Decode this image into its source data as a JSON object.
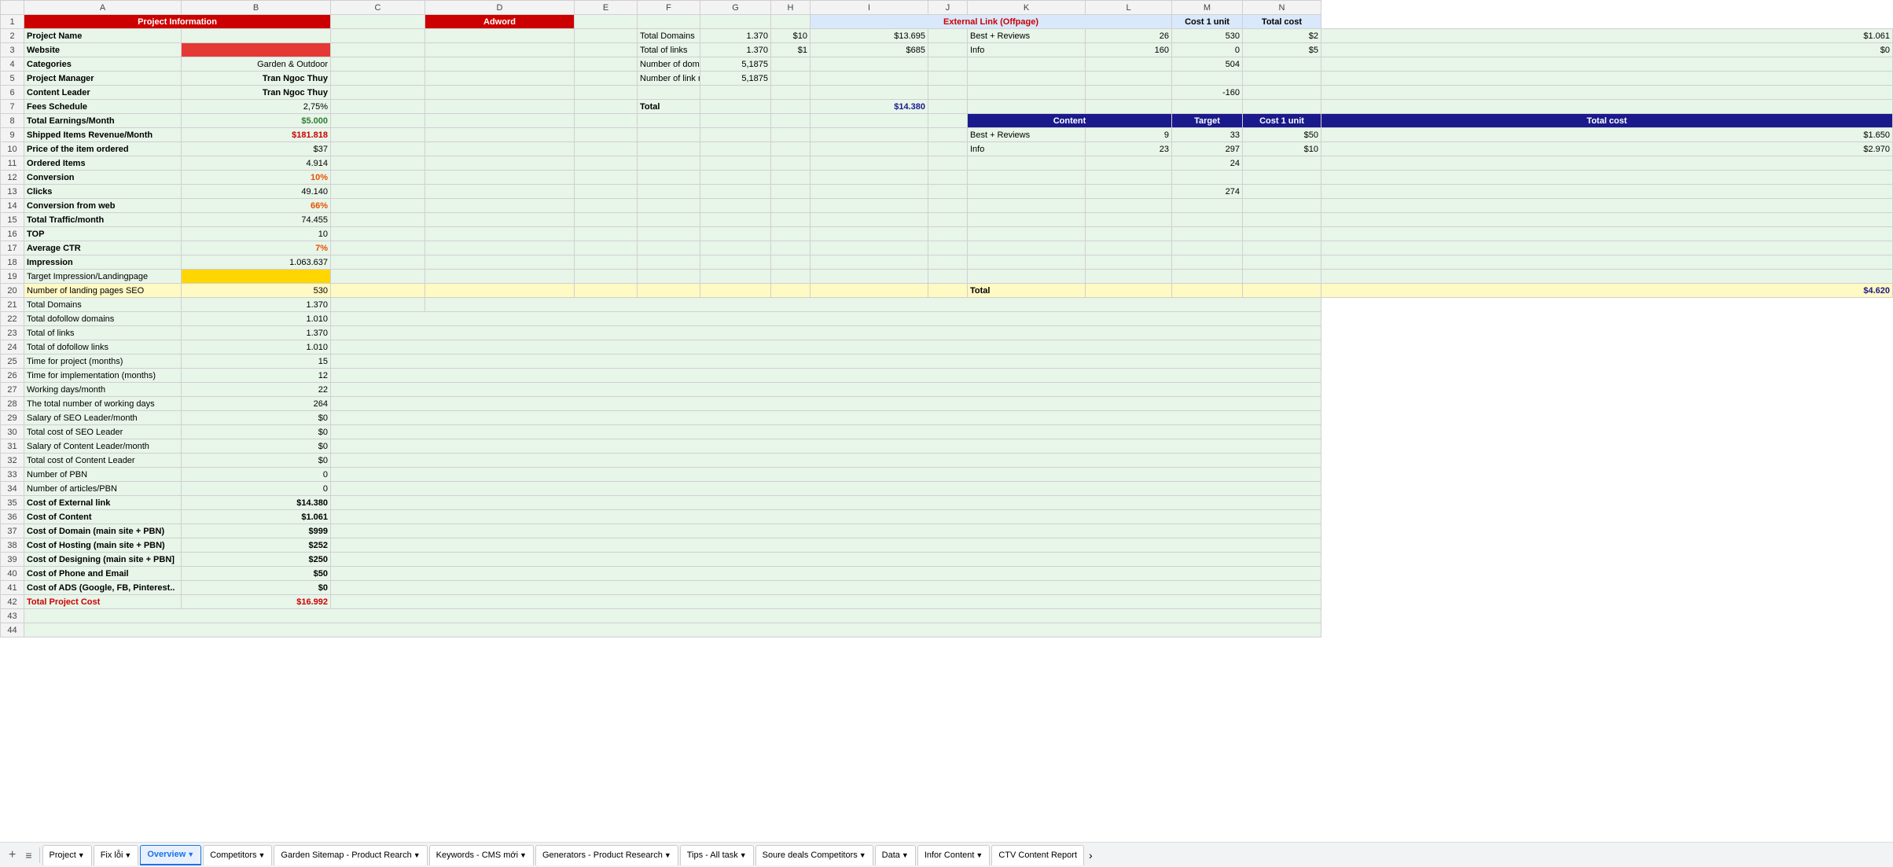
{
  "columns": {
    "row": "",
    "a": "A",
    "b": "B",
    "c": "C",
    "d": "D",
    "e": "E",
    "f": "F",
    "g": "G",
    "h": "H",
    "i": "I",
    "j": "J",
    "k": "K",
    "l": "L",
    "m": "M"
  },
  "rows": [
    {
      "num": 1,
      "a": "Project Information",
      "b": "",
      "c": "",
      "d": "Adword",
      "e": "",
      "f": "",
      "g": "",
      "h": "",
      "i": "External Link (Offpage)",
      "j": "",
      "k": "Cost 1 unit",
      "l": "Total cost",
      "m": "",
      "n": "Content",
      "o": "",
      "p": "Target",
      "q": "Cost 1 unit",
      "r": "Total cost"
    },
    {
      "num": 2,
      "a": "Project Name",
      "b": "",
      "c": "",
      "d": "",
      "e": "",
      "f": "Total Domains",
      "g": "1.370",
      "h": "$10",
      "i": "$13.695",
      "j": "Best + Reviews",
      "k": "26",
      "l": "530",
      "m": "$2",
      "n": "$1.061"
    },
    {
      "num": 3,
      "a": "Website",
      "b": "red",
      "c": "",
      "d": "",
      "e": "",
      "f": "Total of links",
      "g": "1.370",
      "h": "$1",
      "i": "$685",
      "j": "Info",
      "k": "160",
      "l": "0",
      "m": "$5",
      "n": "$0"
    },
    {
      "num": 4,
      "a": "Categories",
      "b": "Garden & Outdoor",
      "c": "",
      "d": "",
      "e": "",
      "f": "Number of domain referring/d",
      "g": "5,1875",
      "h": "",
      "i": "",
      "j": "",
      "k": "",
      "l": "504",
      "m": "",
      "n": ""
    },
    {
      "num": 5,
      "a": "Project Manager",
      "b": "Tran Ngoc Thuy",
      "c": "",
      "d": "",
      "e": "",
      "f": "Number of link referring/day",
      "g": "5,1875",
      "h": "",
      "i": "",
      "j": "",
      "k": "",
      "l": "",
      "m": "",
      "n": ""
    },
    {
      "num": 6,
      "a": "Content Leader",
      "b": "Tran Ngoc Thuy",
      "c": "",
      "d": "",
      "e": "",
      "f": "",
      "g": "",
      "h": "",
      "i": "",
      "j": "",
      "k": "",
      "l": "-160",
      "m": "",
      "n": ""
    },
    {
      "num": 7,
      "a": "Fees Schedule",
      "b": "2,75%",
      "c": "",
      "d": "",
      "e": "",
      "f": "Total",
      "g": "",
      "h": "",
      "i": "$14.380",
      "j": "",
      "k": "",
      "l": "",
      "m": "",
      "n": ""
    },
    {
      "num": 8,
      "a": "Total Earnings/Month",
      "b": "$5.000",
      "c": "",
      "d": "",
      "e": "",
      "f": "",
      "g": "",
      "h": "",
      "i": "",
      "j": "",
      "k": "",
      "l": "",
      "m": "",
      "n": "Total"
    },
    {
      "num": 9,
      "a": "Shipped Items Revenue/Month",
      "b": "$181.818",
      "c": "",
      "d": "",
      "e": "",
      "f": "",
      "g": "",
      "h": "",
      "i": "",
      "j": "Best + Reviews",
      "k": "9",
      "l": "33",
      "m": "$50",
      "n": "$1.650"
    },
    {
      "num": 10,
      "a": "Price of the item ordered",
      "b": "$37",
      "c": "",
      "d": "",
      "e": "",
      "f": "",
      "g": "",
      "h": "",
      "i": "",
      "j": "Info",
      "k": "23",
      "l": "297",
      "m": "$10",
      "n": "$2.970"
    },
    {
      "num": 11,
      "a": "Ordered Items",
      "b": "4.914",
      "c": "",
      "d": "",
      "e": "",
      "f": "",
      "g": "",
      "h": "",
      "i": "",
      "j": "",
      "k": "",
      "l": "24",
      "m": "",
      "n": ""
    },
    {
      "num": 12,
      "a": "Conversion",
      "b": "10%",
      "c": "",
      "d": "",
      "e": "",
      "f": "",
      "g": "",
      "h": "",
      "i": "",
      "j": "",
      "k": "",
      "l": "",
      "m": "",
      "n": ""
    },
    {
      "num": 13,
      "a": "Clicks",
      "b": "49.140",
      "c": "",
      "d": "",
      "e": "",
      "f": "",
      "g": "",
      "h": "",
      "i": "",
      "j": "",
      "k": "",
      "l": "274",
      "m": "",
      "n": ""
    },
    {
      "num": 14,
      "a": "Conversion from web",
      "b": "66%",
      "c": "",
      "d": "",
      "e": "",
      "f": "",
      "g": "",
      "h": "",
      "i": "",
      "j": "",
      "k": "",
      "l": "",
      "m": "",
      "n": ""
    },
    {
      "num": 15,
      "a": "Total Traffic/month",
      "b": "74.455",
      "c": "",
      "d": "",
      "e": "",
      "f": "",
      "g": "",
      "h": "",
      "i": "",
      "j": "",
      "k": "",
      "l": "",
      "m": "",
      "n": ""
    },
    {
      "num": 16,
      "a": "TOP",
      "b": "10",
      "c": "",
      "d": "",
      "e": "",
      "f": "",
      "g": "",
      "h": "",
      "i": "",
      "j": "",
      "k": "",
      "l": "",
      "m": "",
      "n": ""
    },
    {
      "num": 17,
      "a": "Average CTR",
      "b": "7%",
      "c": "",
      "d": "",
      "e": "",
      "f": "",
      "g": "",
      "h": "",
      "i": "",
      "j": "",
      "k": "",
      "l": "",
      "m": "",
      "n": ""
    },
    {
      "num": 18,
      "a": "Impression",
      "b": "1.063.637",
      "c": "",
      "d": "",
      "e": "",
      "f": "",
      "g": "",
      "h": "",
      "i": "",
      "j": "",
      "k": "",
      "l": "",
      "m": "",
      "n": ""
    },
    {
      "num": 19,
      "a": "Target Impression/Landingpage",
      "b": "yellow",
      "c": "",
      "d": "",
      "e": "",
      "f": "",
      "g": "",
      "h": "",
      "i": "",
      "j": "",
      "k": "",
      "l": "",
      "m": "",
      "n": ""
    },
    {
      "num": 20,
      "a": "Number of landing pages SEO",
      "b": "530",
      "c": "",
      "d": "",
      "e": "",
      "f": "",
      "g": "",
      "h": "",
      "i": "",
      "j": "Total",
      "k": "",
      "l": "",
      "m": "",
      "n": "$4.620"
    },
    {
      "num": 21,
      "a": "Total Domains",
      "b": "1.370",
      "c": "",
      "d": "",
      "e": "",
      "f": "",
      "g": "",
      "h": "",
      "i": "",
      "j": "",
      "k": "",
      "l": "",
      "m": "",
      "n": ""
    },
    {
      "num": 22,
      "a": "Total dofollow domains",
      "b": "1.010",
      "c": "",
      "d": "",
      "e": "",
      "f": "",
      "g": "",
      "h": "",
      "i": "",
      "j": "",
      "k": "",
      "l": "",
      "m": "",
      "n": ""
    },
    {
      "num": 23,
      "a": "Total of links",
      "b": "1.370",
      "c": "",
      "d": "",
      "e": "",
      "f": "",
      "g": "",
      "h": "",
      "i": "",
      "j": "",
      "k": "",
      "l": "",
      "m": "",
      "n": ""
    },
    {
      "num": 24,
      "a": "Total of dofollow links",
      "b": "1.010",
      "c": "",
      "d": "",
      "e": "",
      "f": "",
      "g": "",
      "h": "",
      "i": "",
      "j": "",
      "k": "",
      "l": "",
      "m": "",
      "n": ""
    },
    {
      "num": 25,
      "a": "Time for project (months)",
      "b": "15",
      "c": "",
      "d": "",
      "e": "",
      "f": "",
      "g": "",
      "h": "",
      "i": "",
      "j": "",
      "k": "",
      "l": "",
      "m": "",
      "n": ""
    },
    {
      "num": 26,
      "a": "Time for implementation (months)",
      "b": "12",
      "c": "",
      "d": "",
      "e": "",
      "f": "",
      "g": "",
      "h": "",
      "i": "",
      "j": "",
      "k": "",
      "l": "",
      "m": "",
      "n": ""
    },
    {
      "num": 27,
      "a": "Working days/month",
      "b": "22",
      "c": "",
      "d": "",
      "e": "",
      "f": "",
      "g": "",
      "h": "",
      "i": "",
      "j": "",
      "k": "",
      "l": "",
      "m": "",
      "n": ""
    },
    {
      "num": 28,
      "a": "The total number of working days",
      "b": "264",
      "c": "",
      "d": "",
      "e": "",
      "f": "",
      "g": "",
      "h": "",
      "i": "",
      "j": "",
      "k": "",
      "l": "",
      "m": "",
      "n": ""
    },
    {
      "num": 29,
      "a": "Salary of SEO Leader/month",
      "b": "$0",
      "c": "",
      "d": "",
      "e": "",
      "f": "",
      "g": "",
      "h": "",
      "i": "",
      "j": "",
      "k": "",
      "l": "",
      "m": "",
      "n": ""
    },
    {
      "num": 30,
      "a": "Total cost of SEO Leader",
      "b": "$0",
      "c": "",
      "d": "",
      "e": "",
      "f": "",
      "g": "",
      "h": "",
      "i": "",
      "j": "",
      "k": "",
      "l": "",
      "m": "",
      "n": ""
    },
    {
      "num": 31,
      "a": "Salary of Content Leader/month",
      "b": "$0",
      "c": "",
      "d": "",
      "e": "",
      "f": "",
      "g": "",
      "h": "",
      "i": "",
      "j": "",
      "k": "",
      "l": "",
      "m": "",
      "n": ""
    },
    {
      "num": 32,
      "a": "Total cost of Content Leader",
      "b": "$0",
      "c": "",
      "d": "",
      "e": "",
      "f": "",
      "g": "",
      "h": "",
      "i": "",
      "j": "",
      "k": "",
      "l": "",
      "m": "",
      "n": ""
    },
    {
      "num": 33,
      "a": "Number of PBN",
      "b": "0",
      "c": "",
      "d": "",
      "e": "",
      "f": "",
      "g": "",
      "h": "",
      "i": "",
      "j": "",
      "k": "",
      "l": "",
      "m": "",
      "n": ""
    },
    {
      "num": 34,
      "a": "Number of articles/PBN",
      "b": "0",
      "c": "",
      "d": "",
      "e": "",
      "f": "",
      "g": "",
      "h": "",
      "i": "",
      "j": "",
      "k": "",
      "l": "",
      "m": "",
      "n": ""
    },
    {
      "num": 35,
      "a": "Cost of External link",
      "b": "$14.380",
      "c": "",
      "d": "",
      "e": "",
      "f": "",
      "g": "",
      "h": "",
      "i": "",
      "j": "",
      "k": "",
      "l": "",
      "m": "",
      "n": ""
    },
    {
      "num": 36,
      "a": "Cost of Content",
      "b": "$1.061",
      "c": "",
      "d": "",
      "e": "",
      "f": "",
      "g": "",
      "h": "",
      "i": "",
      "j": "",
      "k": "",
      "l": "",
      "m": "",
      "n": ""
    },
    {
      "num": 37,
      "a": "Cost of Domain (main site + PBN)",
      "b": "$999",
      "c": "",
      "d": "",
      "e": "",
      "f": "",
      "g": "",
      "h": "",
      "i": "",
      "j": "",
      "k": "",
      "l": "",
      "m": "",
      "n": ""
    },
    {
      "num": 38,
      "a": "Cost of Hosting (main site + PBN)",
      "b": "$252",
      "c": "",
      "d": "",
      "e": "",
      "f": "",
      "g": "",
      "h": "",
      "i": "",
      "j": "",
      "k": "",
      "l": "",
      "m": "",
      "n": ""
    },
    {
      "num": 39,
      "a": "Cost of Designing (main site + PBN]",
      "b": "$250",
      "c": "",
      "d": "",
      "e": "",
      "f": "",
      "g": "",
      "h": "",
      "i": "",
      "j": "",
      "k": "",
      "l": "",
      "m": "",
      "n": ""
    },
    {
      "num": 40,
      "a": "Cost of Phone and Email",
      "b": "$50",
      "c": "",
      "d": "",
      "e": "",
      "f": "",
      "g": "",
      "h": "",
      "i": "",
      "j": "",
      "k": "",
      "l": "",
      "m": "",
      "n": ""
    },
    {
      "num": 41,
      "a": "Cost of ADS (Google, FB, Pinterest..",
      "b": "$0",
      "c": "",
      "d": "",
      "e": "",
      "f": "",
      "g": "",
      "h": "",
      "i": "",
      "j": "",
      "k": "",
      "l": "",
      "m": "",
      "n": ""
    },
    {
      "num": 42,
      "a": "Total Project Cost",
      "b": "$16.992",
      "c": "",
      "d": "",
      "e": "",
      "f": "",
      "g": "",
      "h": "",
      "i": "",
      "j": "",
      "k": "",
      "l": "",
      "m": "",
      "n": ""
    },
    {
      "num": 43,
      "a": "",
      "b": "",
      "c": "",
      "d": ""
    },
    {
      "num": 44,
      "a": "",
      "b": "",
      "c": "",
      "d": ""
    }
  ],
  "tabs": [
    {
      "label": "+",
      "type": "add"
    },
    {
      "label": "≡",
      "type": "menu"
    },
    {
      "label": "Project",
      "type": "sheet",
      "active": false
    },
    {
      "label": "Fix lỗi",
      "type": "sheet",
      "active": false
    },
    {
      "label": "Overview",
      "type": "sheet",
      "active": true
    },
    {
      "label": "Competitors",
      "type": "sheet",
      "active": false
    },
    {
      "label": "Garden Sitemap - Product Rearch",
      "type": "sheet",
      "active": false
    },
    {
      "label": "Keywords - CMS mới",
      "type": "sheet",
      "active": false
    },
    {
      "label": "Generators - Product Research",
      "type": "sheet",
      "active": false
    },
    {
      "label": "Tips - All task",
      "type": "sheet",
      "active": false
    },
    {
      "label": "Soure deals Competitors",
      "type": "sheet",
      "active": false
    },
    {
      "label": "Data",
      "type": "sheet",
      "active": false
    },
    {
      "label": "Infor Content",
      "type": "sheet",
      "active": false
    },
    {
      "label": "CTV Content Report",
      "type": "sheet",
      "active": false
    }
  ]
}
